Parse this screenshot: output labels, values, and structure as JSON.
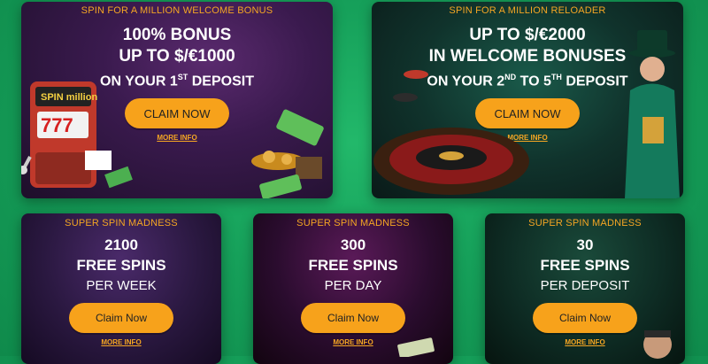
{
  "cards_top": [
    {
      "kicker": "SPIN FOR A MILLION WELCOME BONUS",
      "line1": "100% BONUS",
      "line2": "UP TO $/€1000",
      "line3_pre": "ON YOUR 1",
      "line3_sup": "ST",
      "line3_post": " DEPOSIT",
      "cta": "CLAIM NOW",
      "more": "MORE INFO"
    },
    {
      "kicker": "SPIN FOR A MILLION RELOADER",
      "line1": "UP TO $/€2000",
      "line2": "IN WELCOME BONUSES",
      "line3_pre": "ON YOUR 2",
      "line3_sup": "ND",
      "line3_mid": " TO 5",
      "line3_sup2": "TH",
      "line3_post": " DEPOSIT",
      "cta": "CLAIM NOW",
      "more": "MORE INFO"
    }
  ],
  "cards_bottom": [
    {
      "kicker": "SUPER SPIN MADNESS",
      "line1": "2100",
      "line2": "FREE SPINS",
      "line3": "PER WEEK",
      "cta": "Claim Now",
      "more": "MORE INFO"
    },
    {
      "kicker": "SUPER SPIN MADNESS",
      "line1": "300",
      "line2": "FREE SPINS",
      "line3": "PER DAY",
      "cta": "Claim Now",
      "more": "MORE INFO"
    },
    {
      "kicker": "SUPER SPIN MADNESS",
      "line1": "30",
      "line2": "FREE SPINS",
      "line3": "PER DEPOSIT",
      "cta": "Claim Now",
      "more": "MORE INFO"
    }
  ],
  "decor": {
    "slot_machine_logo": "SPIN million",
    "slot_reels": "777"
  },
  "colors": {
    "background": "#16a05a",
    "accent": "#f5a623",
    "button": "#f7a21b"
  }
}
